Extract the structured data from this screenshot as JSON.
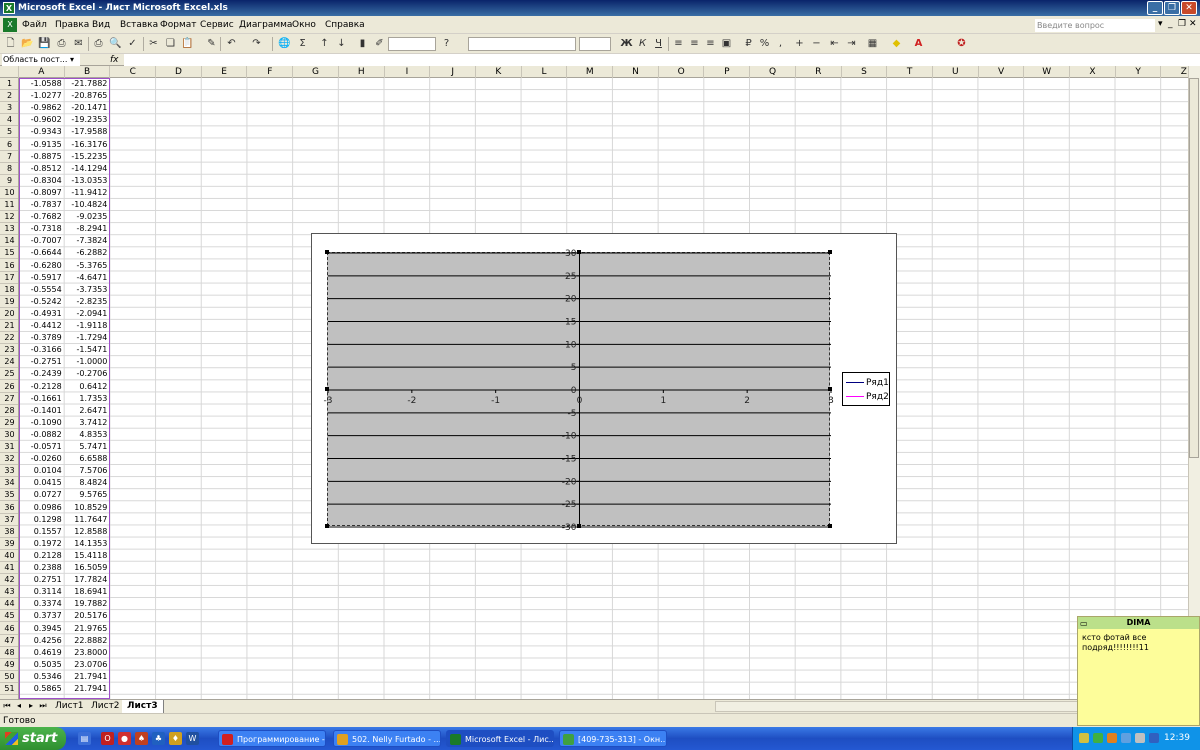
{
  "window": {
    "title": "Microsoft Excel - Лист Microsoft Excel.xls",
    "app_icon": "X"
  },
  "menu": {
    "items": [
      "Файл",
      "Правка",
      "Вид",
      "Вставка",
      "Формат",
      "Сервис",
      "Диаграмма",
      "Окно",
      "Справка"
    ],
    "help_placeholder": "Введите вопрос"
  },
  "formula_bar": {
    "name_box": "Область пост...",
    "fx": "fx",
    "value": ""
  },
  "columns": [
    "A",
    "B",
    "C",
    "D",
    "E",
    "F",
    "G",
    "H",
    "I",
    "J",
    "K",
    "L",
    "M",
    "N",
    "O",
    "P",
    "Q",
    "R",
    "S",
    "T",
    "U",
    "V",
    "W",
    "X",
    "Y",
    "Z"
  ],
  "rows": [
    [
      "-1.0588",
      "-21.7882"
    ],
    [
      "-1.0277",
      "-20.8765"
    ],
    [
      "-0.9862",
      "-20.1471"
    ],
    [
      "-0.9602",
      "-19.2353"
    ],
    [
      "-0.9343",
      "-17.9588"
    ],
    [
      "-0.9135",
      "-16.3176"
    ],
    [
      "-0.8875",
      "-15.2235"
    ],
    [
      "-0.8512",
      "-14.1294"
    ],
    [
      "-0.8304",
      "-13.0353"
    ],
    [
      "-0.8097",
      "-11.9412"
    ],
    [
      "-0.7837",
      "-10.4824"
    ],
    [
      "-0.7682",
      "-9.0235"
    ],
    [
      "-0.7318",
      "-8.2941"
    ],
    [
      "-0.7007",
      "-7.3824"
    ],
    [
      "-0.6644",
      "-6.2882"
    ],
    [
      "-0.6280",
      "-5.3765"
    ],
    [
      "-0.5917",
      "-4.6471"
    ],
    [
      "-0.5554",
      "-3.7353"
    ],
    [
      "-0.5242",
      "-2.8235"
    ],
    [
      "-0.4931",
      "-2.0941"
    ],
    [
      "-0.4412",
      "-1.9118"
    ],
    [
      "-0.3789",
      "-1.7294"
    ],
    [
      "-0.3166",
      "-1.5471"
    ],
    [
      "-0.2751",
      "-1.0000"
    ],
    [
      "-0.2439",
      "-0.2706"
    ],
    [
      "-0.2128",
      "0.6412"
    ],
    [
      "-0.1661",
      "1.7353"
    ],
    [
      "-0.1401",
      "2.6471"
    ],
    [
      "-0.1090",
      "3.7412"
    ],
    [
      "-0.0882",
      "4.8353"
    ],
    [
      "-0.0571",
      "5.7471"
    ],
    [
      "-0.0260",
      "6.6588"
    ],
    [
      "0.0104",
      "7.5706"
    ],
    [
      "0.0415",
      "8.4824"
    ],
    [
      "0.0727",
      "9.5765"
    ],
    [
      "0.0986",
      "10.8529"
    ],
    [
      "0.1298",
      "11.7647"
    ],
    [
      "0.1557",
      "12.8588"
    ],
    [
      "0.1972",
      "14.1353"
    ],
    [
      "0.2128",
      "15.4118"
    ],
    [
      "0.2388",
      "16.5059"
    ],
    [
      "0.2751",
      "17.7824"
    ],
    [
      "0.3114",
      "18.6941"
    ],
    [
      "0.3374",
      "19.7882"
    ],
    [
      "0.3737",
      "20.5176"
    ],
    [
      "0.3945",
      "21.9765"
    ],
    [
      "0.4256",
      "22.8882"
    ],
    [
      "0.4619",
      "23.8000"
    ],
    [
      "0.5035",
      "23.0706"
    ],
    [
      "0.5346",
      "21.7941"
    ],
    [
      "0.5865",
      "21.7941"
    ]
  ],
  "chart_data": {
    "type": "scatter",
    "title": "",
    "xlabel": "",
    "ylabel": "",
    "xlim": [
      -3,
      3
    ],
    "ylim": [
      -30,
      30
    ],
    "x_ticks": [
      "-3",
      "-2",
      "-1",
      "0",
      "1",
      "2",
      "3"
    ],
    "y_ticks": [
      "30",
      "25",
      "20",
      "15",
      "10",
      "5",
      "0",
      "-5",
      "-10",
      "-15",
      "-20",
      "-25",
      "-30"
    ],
    "grid": "horizontal",
    "legend_position": "right",
    "plot_background": "#c0c0c0",
    "series": [
      {
        "name": "Ряд1",
        "color": "#000080",
        "values": []
      },
      {
        "name": "Ряд2",
        "color": "#ff00ff",
        "values": []
      }
    ]
  },
  "sheets": {
    "tabs": [
      "Лист1",
      "Лист2",
      "Лист3"
    ],
    "active": "Лист3"
  },
  "status": "Готово",
  "note": {
    "title": "DIMA",
    "text": "ксто фотай все подряд!!!!!!!!11"
  },
  "taskbar": {
    "start": "start",
    "tasks": [
      {
        "label": "Программирование -...",
        "icon_color": "#d02020"
      },
      {
        "label": "502. Nelly Furtado - ...",
        "icon_color": "#e0a020"
      },
      {
        "label": "Microsoft Excel - Лис...",
        "icon_color": "#1a7a2a"
      },
      {
        "label": "[409-735-313] - Окн...",
        "icon_color": "#40a040"
      }
    ],
    "clock": "12:39"
  }
}
